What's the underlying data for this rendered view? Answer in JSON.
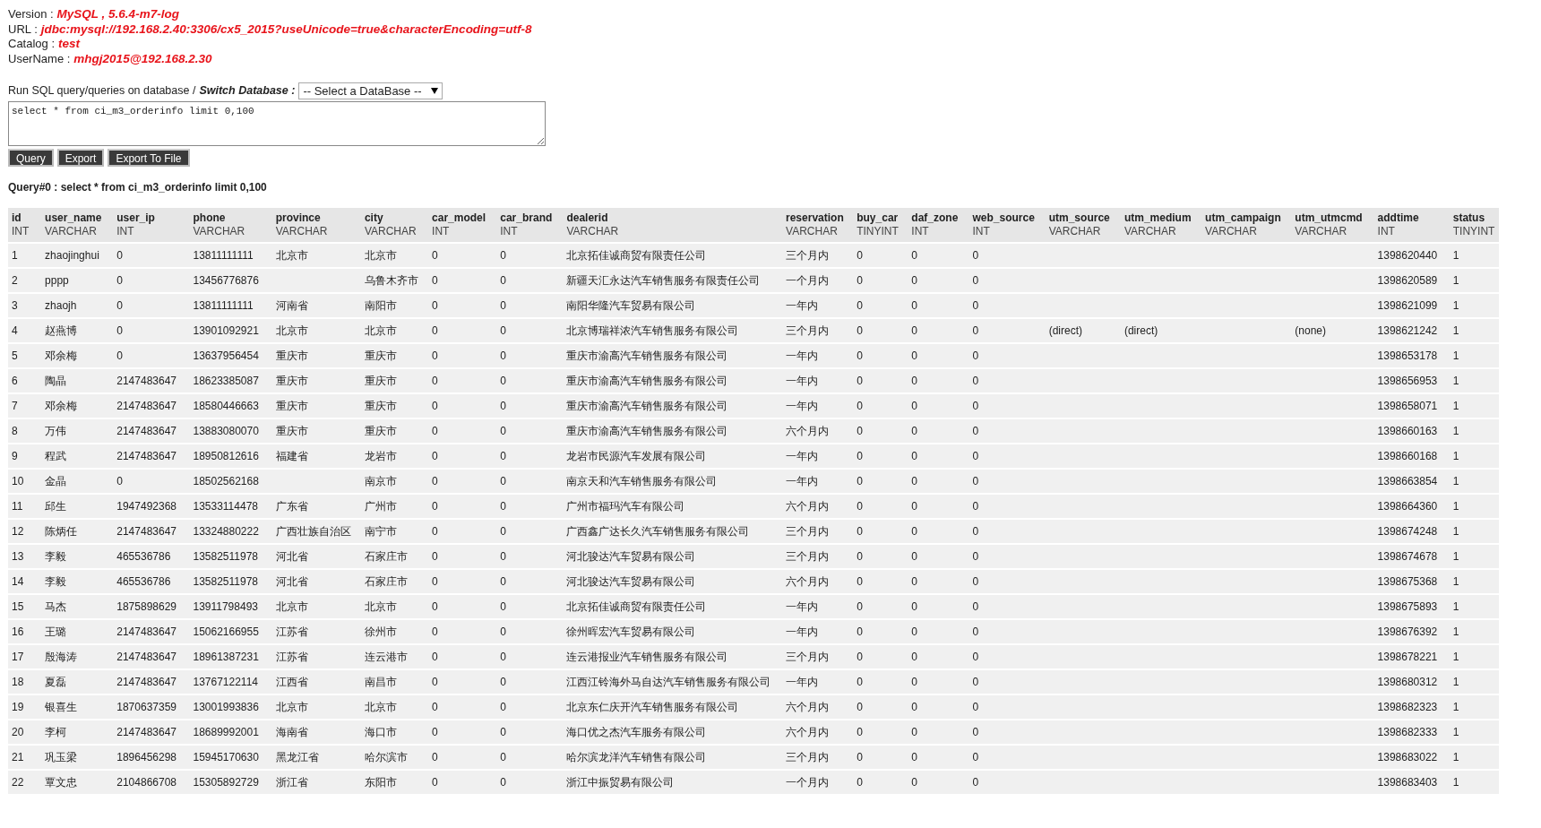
{
  "info": [
    {
      "label": "Version :",
      "value": "MySQL , 5.6.4-m7-log"
    },
    {
      "label": "URL :",
      "value": "jdbc:mysql://192.168.2.40:3306/cx5_2015?useUnicode=true&characterEncoding=utf-8"
    },
    {
      "label": "Catalog :",
      "value": "test"
    },
    {
      "label": "UserName :",
      "value": "mhgj2015@192.168.2.30"
    }
  ],
  "query_form": {
    "prompt": "Run SQL query/queries on database /",
    "switch_label": "Switch Database :",
    "database_select": "-- Select a DataBase --",
    "sql": "select * from ci_m3_orderinfo limit 0,100",
    "buttons": [
      "Query",
      "Export",
      "Export To File"
    ]
  },
  "query_title": "Query#0 : select * from ci_m3_orderinfo limit 0,100",
  "table": {
    "columns": [
      {
        "name": "id",
        "type": "INT"
      },
      {
        "name": "user_name",
        "type": "VARCHAR"
      },
      {
        "name": "user_ip",
        "type": "INT"
      },
      {
        "name": "phone",
        "type": "VARCHAR"
      },
      {
        "name": "province",
        "type": "VARCHAR"
      },
      {
        "name": "city",
        "type": "VARCHAR"
      },
      {
        "name": "car_model",
        "type": "INT"
      },
      {
        "name": "car_brand",
        "type": "INT"
      },
      {
        "name": "dealerid",
        "type": "VARCHAR"
      },
      {
        "name": "reservation",
        "type": "VARCHAR"
      },
      {
        "name": "buy_car",
        "type": "TINYINT"
      },
      {
        "name": "daf_zone",
        "type": "INT"
      },
      {
        "name": "web_source",
        "type": "INT"
      },
      {
        "name": "utm_source",
        "type": "VARCHAR"
      },
      {
        "name": "utm_medium",
        "type": "VARCHAR"
      },
      {
        "name": "utm_campaign",
        "type": "VARCHAR"
      },
      {
        "name": "utm_utmcmd",
        "type": "VARCHAR"
      },
      {
        "name": "addtime",
        "type": "INT"
      },
      {
        "name": "status",
        "type": "TINYINT"
      }
    ],
    "rows": [
      [
        "1",
        "zhaojinghui",
        "0",
        "13811111111",
        "北京市",
        "北京市",
        "0",
        "0",
        "北京拓佳诚商贸有限责任公司",
        "三个月内",
        "0",
        "0",
        "0",
        null,
        null,
        null,
        null,
        "1398620440",
        "1"
      ],
      [
        "2",
        "pppp",
        "0",
        "13456776876",
        null,
        "乌鲁木齐市",
        "0",
        "0",
        "新疆天汇永达汽车销售服务有限责任公司",
        "一个月内",
        "0",
        "0",
        "0",
        null,
        null,
        null,
        null,
        "1398620589",
        "1"
      ],
      [
        "3",
        "zhaojh",
        "0",
        "13811111111",
        "河南省",
        "南阳市",
        "0",
        "0",
        "南阳华隆汽车贸易有限公司",
        "一年内",
        "0",
        "0",
        "0",
        null,
        null,
        null,
        null,
        "1398621099",
        "1"
      ],
      [
        "4",
        "赵燕博",
        "0",
        "13901092921",
        "北京市",
        "北京市",
        "0",
        "0",
        "北京博瑞祥浓汽车销售服务有限公司",
        "三个月内",
        "0",
        "0",
        "0",
        "(direct)",
        "(direct)",
        null,
        "(none)",
        "1398621242",
        "1"
      ],
      [
        "5",
        "邓余梅",
        "0",
        "13637956454",
        "重庆市",
        "重庆市",
        "0",
        "0",
        "重庆市渝高汽车销售服务有限公司",
        "一年内",
        "0",
        "0",
        "0",
        null,
        null,
        null,
        null,
        "1398653178",
        "1"
      ],
      [
        "6",
        "陶晶",
        "2147483647",
        "18623385087",
        "重庆市",
        "重庆市",
        "0",
        "0",
        "重庆市渝高汽车销售服务有限公司",
        "一年内",
        "0",
        "0",
        "0",
        null,
        null,
        null,
        null,
        "1398656953",
        "1"
      ],
      [
        "7",
        "邓余梅",
        "2147483647",
        "18580446663",
        "重庆市",
        "重庆市",
        "0",
        "0",
        "重庆市渝高汽车销售服务有限公司",
        "一年内",
        "0",
        "0",
        "0",
        null,
        null,
        null,
        null,
        "1398658071",
        "1"
      ],
      [
        "8",
        "万伟",
        "2147483647",
        "13883080070",
        "重庆市",
        "重庆市",
        "0",
        "0",
        "重庆市渝高汽车销售服务有限公司",
        "六个月内",
        "0",
        "0",
        "0",
        null,
        null,
        null,
        null,
        "1398660163",
        "1"
      ],
      [
        "9",
        "程武",
        "2147483647",
        "18950812616",
        "福建省",
        "龙岩市",
        "0",
        "0",
        "龙岩市民源汽车发展有限公司",
        "一年内",
        "0",
        "0",
        "0",
        null,
        null,
        null,
        null,
        "1398660168",
        "1"
      ],
      [
        "10",
        "金晶",
        "0",
        "18502562168",
        null,
        "南京市",
        "0",
        "0",
        "南京天和汽车销售服务有限公司",
        "一年内",
        "0",
        "0",
        "0",
        null,
        null,
        null,
        null,
        "1398663854",
        "1"
      ],
      [
        "11",
        "邱生",
        "1947492368",
        "13533114478",
        "广东省",
        "广州市",
        "0",
        "0",
        "广州市福玛汽车有限公司",
        "六个月内",
        "0",
        "0",
        "0",
        null,
        null,
        null,
        null,
        "1398664360",
        "1"
      ],
      [
        "12",
        "陈炳任",
        "2147483647",
        "13324880222",
        "广西壮族自治区",
        "南宁市",
        "0",
        "0",
        "广西鑫广达长久汽车销售服务有限公司",
        "三个月内",
        "0",
        "0",
        "0",
        null,
        null,
        null,
        null,
        "1398674248",
        "1"
      ],
      [
        "13",
        "李毅",
        "465536786",
        "13582511978",
        "河北省",
        "石家庄市",
        "0",
        "0",
        "河北骏达汽车贸易有限公司",
        "三个月内",
        "0",
        "0",
        "0",
        null,
        null,
        null,
        null,
        "1398674678",
        "1"
      ],
      [
        "14",
        "李毅",
        "465536786",
        "13582511978",
        "河北省",
        "石家庄市",
        "0",
        "0",
        "河北骏达汽车贸易有限公司",
        "六个月内",
        "0",
        "0",
        "0",
        null,
        null,
        null,
        null,
        "1398675368",
        "1"
      ],
      [
        "15",
        "马杰",
        "1875898629",
        "13911798493",
        "北京市",
        "北京市",
        "0",
        "0",
        "北京拓佳诚商贸有限责任公司",
        "一年内",
        "0",
        "0",
        "0",
        null,
        null,
        null,
        null,
        "1398675893",
        "1"
      ],
      [
        "16",
        "王璐",
        "2147483647",
        "15062166955",
        "江苏省",
        "徐州市",
        "0",
        "0",
        "徐州晖宏汽车贸易有限公司",
        "一年内",
        "0",
        "0",
        "0",
        null,
        null,
        null,
        null,
        "1398676392",
        "1"
      ],
      [
        "17",
        "殷海涛",
        "2147483647",
        "18961387231",
        "江苏省",
        "连云港市",
        "0",
        "0",
        "连云港报业汽车销售服务有限公司",
        "三个月内",
        "0",
        "0",
        "0",
        null,
        null,
        null,
        null,
        "1398678221",
        "1"
      ],
      [
        "18",
        "夏磊",
        "2147483647",
        "13767122114",
        "江西省",
        "南昌市",
        "0",
        "0",
        "江西江铃海外马自达汽车销售服务有限公司",
        "一年内",
        "0",
        "0",
        "0",
        null,
        null,
        null,
        null,
        "1398680312",
        "1"
      ],
      [
        "19",
        "银喜生",
        "1870637359",
        "13001993836",
        "北京市",
        "北京市",
        "0",
        "0",
        "北京东仁庆开汽车销售服务有限公司",
        "六个月内",
        "0",
        "0",
        "0",
        null,
        null,
        null,
        null,
        "1398682323",
        "1"
      ],
      [
        "20",
        "李柯",
        "2147483647",
        "18689992001",
        "海南省",
        "海口市",
        "0",
        "0",
        "海口优之杰汽车服务有限公司",
        "六个月内",
        "0",
        "0",
        "0",
        null,
        null,
        null,
        null,
        "1398682333",
        "1"
      ],
      [
        "21",
        "巩玉梁",
        "1896456298",
        "15945170630",
        "黑龙江省",
        "哈尔滨市",
        "0",
        "0",
        "哈尔滨龙洋汽车销售有限公司",
        "三个月内",
        "0",
        "0",
        "0",
        null,
        null,
        null,
        null,
        "1398683022",
        "1"
      ],
      [
        "22",
        "覃文忠",
        "2104866708",
        "15305892729",
        "浙江省",
        "东阳市",
        "0",
        "0",
        "浙江中振贸易有限公司",
        "一个月内",
        "0",
        "0",
        "0",
        null,
        null,
        null,
        null,
        "1398683403",
        "1"
      ]
    ]
  }
}
